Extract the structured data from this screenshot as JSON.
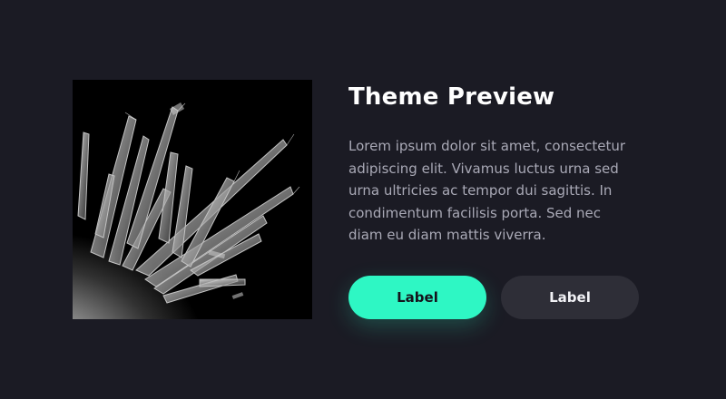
{
  "card": {
    "image_alt": "Crystal cluster photograph",
    "title": "Theme Preview",
    "body": "Lorem ipsum dolor sit amet, consectetur adipiscing elit. Vivamus luctus urna sed urna ultricies ac tempor dui sagittis. In condimentum facilisis porta. Sed nec diam eu diam mattis viverra.",
    "primary_button_label": "Label",
    "secondary_button_label": "Label"
  },
  "colors": {
    "background": "#1b1b24",
    "accent": "#2ef7c4",
    "secondary_button": "#2e2e37",
    "body_text": "#a9a9b6"
  }
}
